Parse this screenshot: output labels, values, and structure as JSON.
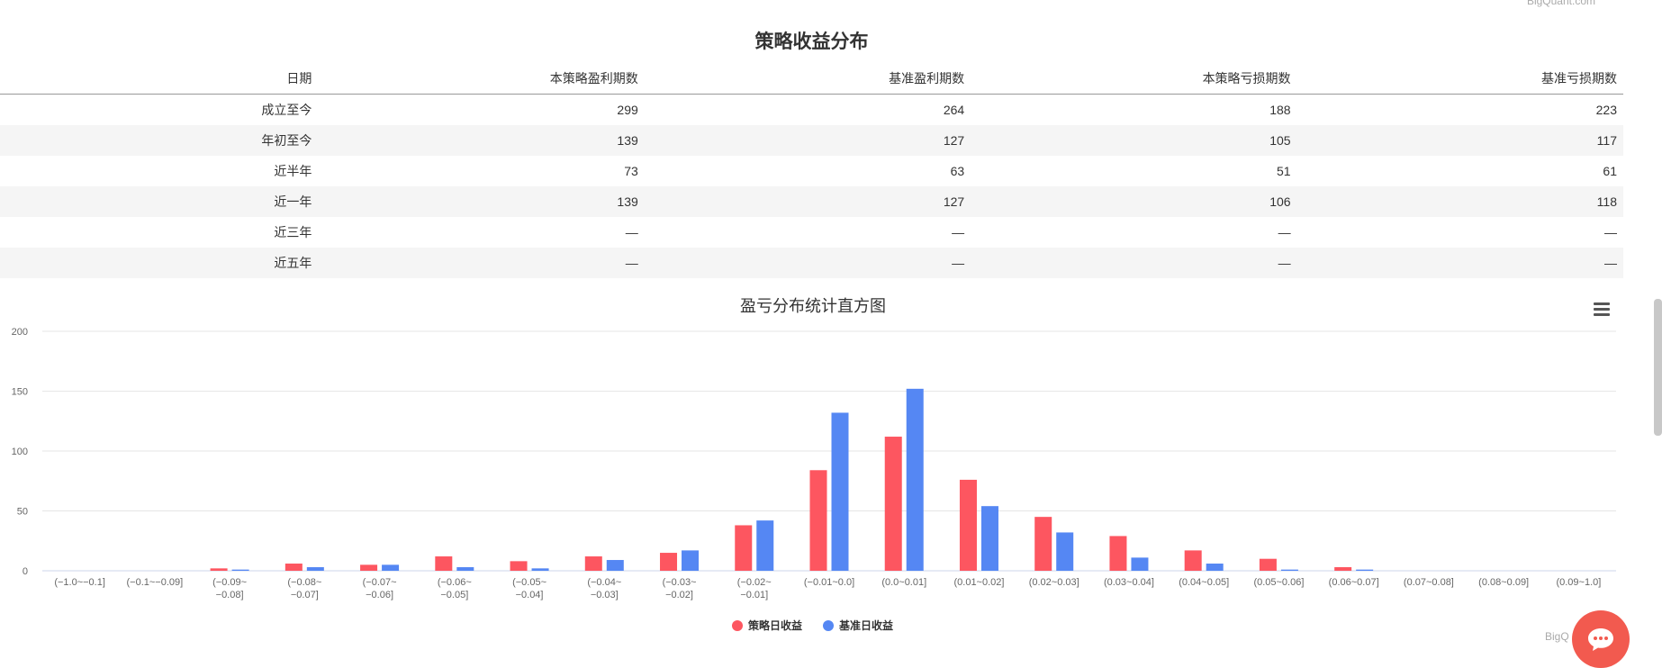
{
  "watermark": {
    "top": "BigQuant.com",
    "bottom": "BigQ"
  },
  "table": {
    "title": "策略收益分布",
    "headers": [
      "日期",
      "本策略盈利期数",
      "基准盈利期数",
      "本策略亏损期数",
      "基准亏损期数"
    ],
    "rows": [
      [
        "成立至今",
        "299",
        "264",
        "188",
        "223"
      ],
      [
        "年初至今",
        "139",
        "127",
        "105",
        "117"
      ],
      [
        "近半年",
        "73",
        "63",
        "51",
        "61"
      ],
      [
        "近一年",
        "139",
        "127",
        "106",
        "118"
      ],
      [
        "近三年",
        "—",
        "—",
        "—",
        "—"
      ],
      [
        "近五年",
        "—",
        "—",
        "—",
        "—"
      ]
    ]
  },
  "chart_data": {
    "type": "bar",
    "title": "盈亏分布统计直方图",
    "xlabel": "",
    "ylabel": "",
    "ylim": [
      0,
      200
    ],
    "yticks": [
      0,
      50,
      100,
      150,
      200
    ],
    "grid": true,
    "legend_position": "bottom-center",
    "categories": [
      "(−1.0~−0.1]",
      "(−0.1~−0.09]",
      "(−0.09~−0.08]",
      "(−0.08~−0.07]",
      "(−0.07~−0.06]",
      "(−0.06~−0.05]",
      "(−0.05~−0.04]",
      "(−0.04~−0.03]",
      "(−0.03~−0.02]",
      "(−0.02~−0.01]",
      "(−0.01~0.0]",
      "(0.0~0.01]",
      "(0.01~0.02]",
      "(0.02~0.03]",
      "(0.03~0.04]",
      "(0.04~0.05]",
      "(0.05~0.06]",
      "(0.06~0.07]",
      "(0.07~0.08]",
      "(0.08~0.09]",
      "(0.09~1.0]"
    ],
    "series": [
      {
        "name": "策略日收益",
        "color": "#fd5660",
        "values": [
          0,
          0,
          2,
          6,
          5,
          12,
          8,
          12,
          15,
          38,
          84,
          112,
          76,
          45,
          29,
          17,
          10,
          3,
          0,
          0,
          0
        ]
      },
      {
        "name": "基准日收益",
        "color": "#5587f3",
        "values": [
          0,
          0,
          1,
          3,
          5,
          3,
          2,
          9,
          17,
          42,
          132,
          152,
          54,
          32,
          11,
          6,
          1,
          1,
          0,
          0,
          0
        ]
      }
    ]
  },
  "colors": {
    "strategy": "#fd5660",
    "benchmark": "#5587f3",
    "chat": "#f25a4f"
  },
  "icons": {
    "menu": "hamburger-menu-icon",
    "chat": "chat-bubble-icon"
  }
}
